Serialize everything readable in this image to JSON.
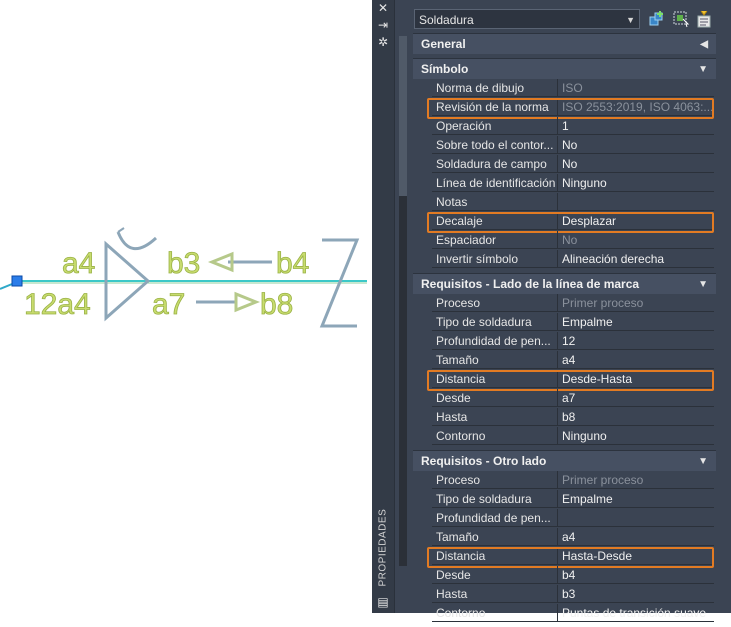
{
  "drawing": {
    "weld_labels": [
      "a4",
      "b3",
      "b4",
      "12a4",
      "a7",
      "b8"
    ]
  },
  "palette": {
    "side_title": "PROPIEDADES",
    "object_type": "Soldadura",
    "categories": [
      {
        "title": "General",
        "collapsed": true,
        "rows": []
      },
      {
        "title": "Símbolo",
        "collapsed": false,
        "rows": [
          {
            "label": "Norma de dibujo",
            "value": "ISO",
            "dim": true,
            "highlight": false
          },
          {
            "label": "Revisión de la norma",
            "value": "ISO 2553:2019, ISO 4063:...",
            "dim": true,
            "highlight": true
          },
          {
            "label": "Operación",
            "value": "1",
            "dim": false,
            "highlight": false
          },
          {
            "label": "Sobre todo el contor...",
            "value": "No",
            "dim": false,
            "highlight": false
          },
          {
            "label": "Soldadura de campo",
            "value": "No",
            "dim": false,
            "highlight": false
          },
          {
            "label": "Línea de identificación",
            "value": "Ninguno",
            "dim": false,
            "highlight": false
          },
          {
            "label": "Notas",
            "value": "",
            "dim": false,
            "highlight": false
          },
          {
            "label": "Decalaje",
            "value": "Desplazar",
            "dim": false,
            "highlight": true
          },
          {
            "label": "Espaciador",
            "value": "No",
            "dim": true,
            "highlight": false
          },
          {
            "label": "Invertir símbolo",
            "value": "Alineación derecha",
            "dim": false,
            "highlight": false
          }
        ]
      },
      {
        "title": "Requisitos - Lado de la línea de marca",
        "collapsed": false,
        "rows": [
          {
            "label": "Proceso",
            "value": "Primer proceso",
            "dim": true,
            "highlight": false
          },
          {
            "label": "Tipo de soldadura",
            "value": "Empalme",
            "dim": false,
            "highlight": false
          },
          {
            "label": "Profundidad de pen...",
            "value": "12",
            "dim": false,
            "highlight": false
          },
          {
            "label": "Tamaño",
            "value": "a4",
            "dim": false,
            "highlight": false
          },
          {
            "label": "Distancia",
            "value": "Desde-Hasta",
            "dim": false,
            "highlight": true
          },
          {
            "label": "Desde",
            "value": "a7",
            "dim": false,
            "highlight": false
          },
          {
            "label": "Hasta",
            "value": "b8",
            "dim": false,
            "highlight": false
          },
          {
            "label": "Contorno",
            "value": "Ninguno",
            "dim": false,
            "highlight": false
          }
        ]
      },
      {
        "title": "Requisitos - Otro lado",
        "collapsed": false,
        "rows": [
          {
            "label": "Proceso",
            "value": "Primer proceso",
            "dim": true,
            "highlight": false
          },
          {
            "label": "Tipo de soldadura",
            "value": "Empalme",
            "dim": false,
            "highlight": false
          },
          {
            "label": "Profundidad de pen...",
            "value": "",
            "dim": false,
            "highlight": false
          },
          {
            "label": "Tamaño",
            "value": "a4",
            "dim": false,
            "highlight": false
          },
          {
            "label": "Distancia",
            "value": "Hasta-Desde",
            "dim": false,
            "highlight": true
          },
          {
            "label": "Desde",
            "value": "b4",
            "dim": false,
            "highlight": false
          },
          {
            "label": "Hasta",
            "value": "b3",
            "dim": false,
            "highlight": false
          },
          {
            "label": "Contorno",
            "value": "Puntas de transición suave",
            "dim": false,
            "highlight": false
          }
        ]
      }
    ]
  },
  "colors": {
    "highlight": "#e27b23",
    "weld_text": "#c8dc6e",
    "reference_line": "#3cc8c8",
    "palette_bg": "#3b4453"
  }
}
